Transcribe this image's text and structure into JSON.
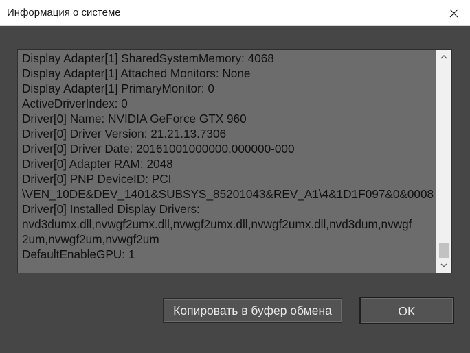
{
  "window": {
    "title": "Информация о системе"
  },
  "text_lines": [
    "Display Adapter[1]  SharedSystemMemory: 4068",
    "Display Adapter[1]  Attached Monitors: None",
    "Display Adapter[1]  PrimaryMonitor: 0",
    "ActiveDriverIndex: 0",
    "Driver[0] Name: NVIDIA GeForce GTX 960",
    "Driver[0] Driver Version: 21.21.13.7306",
    "Driver[0] Driver Date: 20161001000000.000000-000",
    "Driver[0] Adapter RAM: 2048",
    "Driver[0] PNP DeviceID: PCI",
    "\\VEN_10DE&DEV_1401&SUBSYS_85201043&REV_A1\\4&1D1F097&0&0008",
    "Driver[0] Installed Display Drivers:",
    "nvd3dumx.dll,nvwgf2umx.dll,nvwgf2umx.dll,nvwgf2umx.dll,nvd3dum,nvwgf",
    "2um,nvwgf2um,nvwgf2um",
    "DefaultEnableGPU: 1"
  ],
  "buttons": {
    "copy_label": "Копировать в буфер обмена",
    "ok_label": "OK"
  },
  "scrollbar": {
    "position_fraction": 1.0
  },
  "icons": {
    "close": "close-icon",
    "scroll_up": "chevron-up-icon",
    "scroll_down": "chevron-down-icon"
  },
  "colors": {
    "background": "#464646",
    "textarea_bg": "#6c6c6c",
    "text": "#111111",
    "button_bg": "#535353",
    "button_text": "#e8e8e8",
    "titlebar_bg": "#ffffff"
  }
}
